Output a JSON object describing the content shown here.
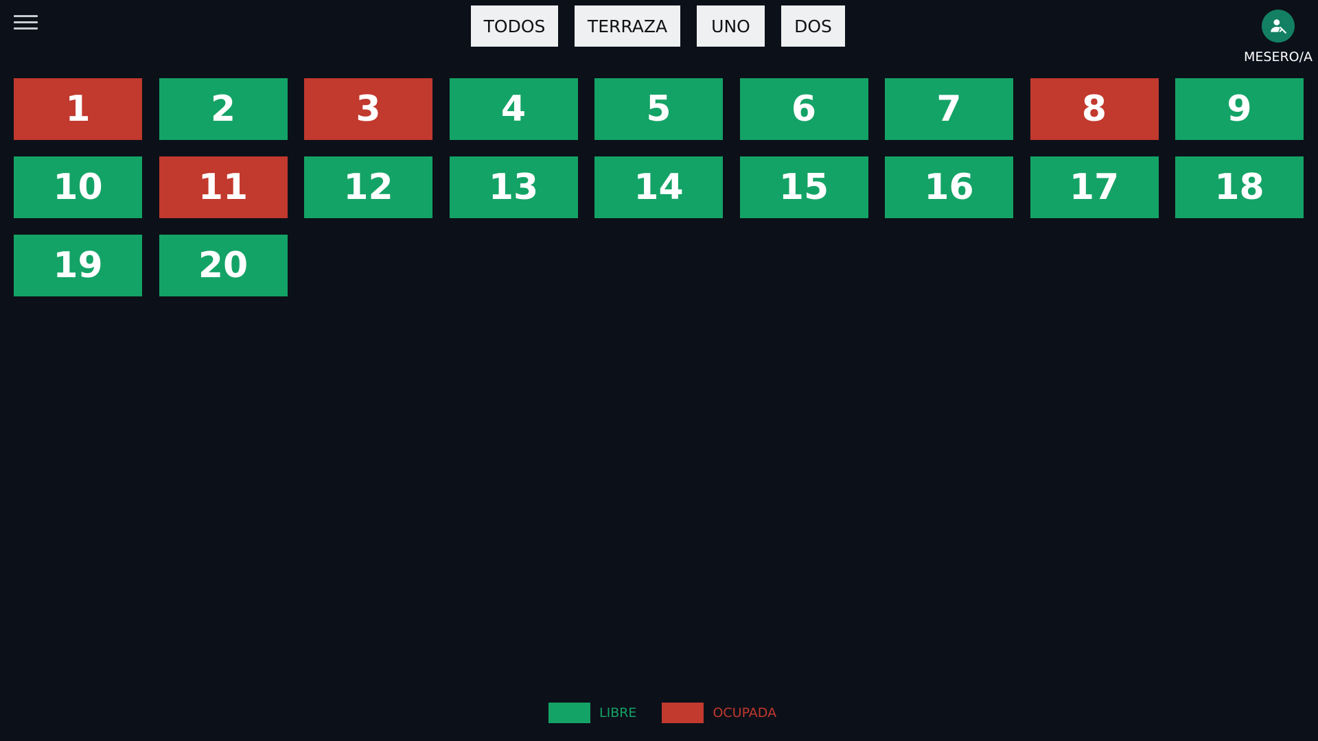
{
  "header": {
    "menu_icon": "hamburger-menu-icon",
    "filters": [
      {
        "label": "TODOS"
      },
      {
        "label": "TERRAZA"
      },
      {
        "label": "UNO"
      },
      {
        "label": "DOS"
      }
    ],
    "user": {
      "icon": "person-icon",
      "label": "MESERO/A",
      "avatar_color": "#138064"
    }
  },
  "colors": {
    "libre": "#14a366",
    "ocupada": "#c2392e",
    "background": "#0c1019"
  },
  "tables": [
    {
      "number": "1",
      "status": "ocupada"
    },
    {
      "number": "2",
      "status": "libre"
    },
    {
      "number": "3",
      "status": "ocupada"
    },
    {
      "number": "4",
      "status": "libre"
    },
    {
      "number": "5",
      "status": "libre"
    },
    {
      "number": "6",
      "status": "libre"
    },
    {
      "number": "7",
      "status": "libre"
    },
    {
      "number": "8",
      "status": "ocupada"
    },
    {
      "number": "9",
      "status": "libre"
    },
    {
      "number": "10",
      "status": "libre"
    },
    {
      "number": "11",
      "status": "ocupada"
    },
    {
      "number": "12",
      "status": "libre"
    },
    {
      "number": "13",
      "status": "libre"
    },
    {
      "number": "14",
      "status": "libre"
    },
    {
      "number": "15",
      "status": "libre"
    },
    {
      "number": "16",
      "status": "libre"
    },
    {
      "number": "17",
      "status": "libre"
    },
    {
      "number": "18",
      "status": "libre"
    },
    {
      "number": "19",
      "status": "libre"
    },
    {
      "number": "20",
      "status": "libre"
    }
  ],
  "legend": {
    "libre_label": "LIBRE",
    "ocupada_label": "OCUPADA"
  }
}
